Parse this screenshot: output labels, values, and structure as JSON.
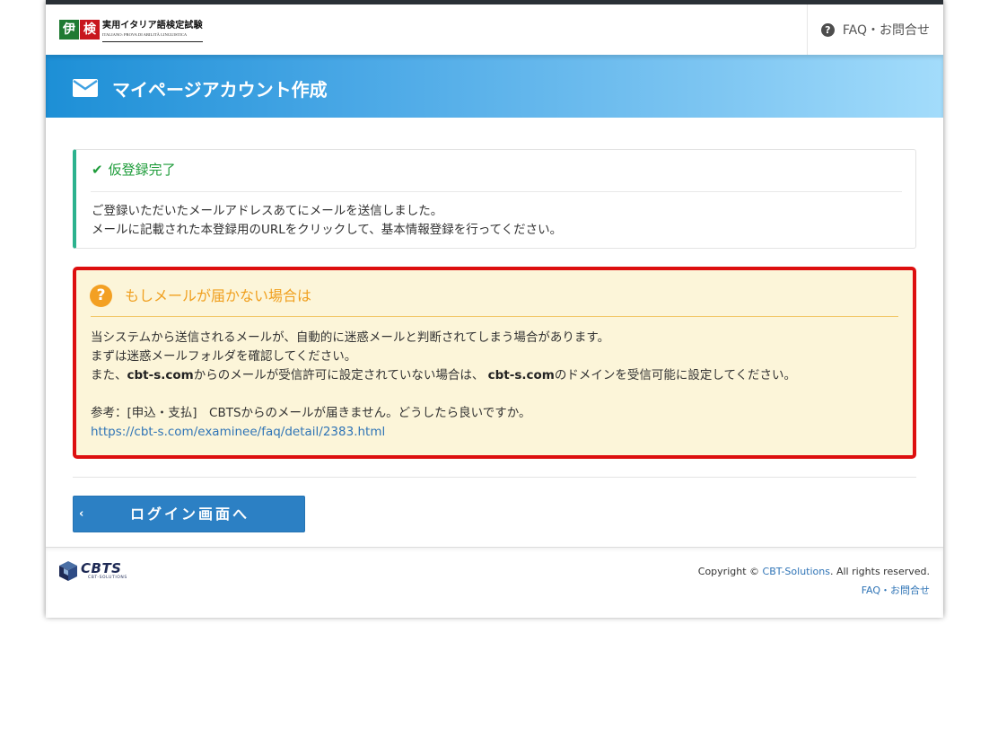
{
  "header": {
    "logo": {
      "mark_left": "伊",
      "mark_right": "検",
      "title": "実用イタリア語検定試験",
      "subtitle": "ITALIANO: PROVA DI ABILITÀ LINGUISTICA"
    },
    "faq_link": "FAQ・お問合せ",
    "faq_icon": "question-circle-icon"
  },
  "banner": {
    "icon": "envelope-icon",
    "title": "マイページアカウント作成"
  },
  "success_panel": {
    "icon": "check-icon",
    "title": "仮登録完了",
    "lines": [
      "ご登録いただいたメールアドレスあてにメールを送信しました。",
      "メールに記載された本登録用のURLをクリックして、基本情報登録を行ってください。"
    ]
  },
  "warning_panel": {
    "icon": "question-circle-icon",
    "title": "もしメールが届かない場合は",
    "line1": "当システムから送信されるメールが、自動的に迷惑メールと判断されてしまう場合があります。",
    "line2": "まずは迷惑メールフォルダを確認してください。",
    "line3_prefix": "また、",
    "line3_domain1": "cbt-s.com",
    "line3_middle": "からのメールが受信許可に設定されていない場合は、 ",
    "line3_domain2": "cbt-s.com",
    "line3_suffix": "のドメインを受信可能に設定してください。",
    "reference": "参考：[申込・支払]　CBTSからのメールが届きません。どうしたら良いですか。",
    "reference_url": "https://cbt-s.com/examinee/faq/detail/2383.html"
  },
  "login_button": {
    "chevron": "‹",
    "label": "ログイン画面へ"
  },
  "footer": {
    "logo_text": "CBTS",
    "logo_sub": "CBT-SOLUTIONS",
    "copyright_prefix": "Copyright © ",
    "copyright_link": "CBT-Solutions",
    "copyright_suffix": ". All rights reserved.",
    "faq_link": "FAQ・お問合せ"
  },
  "colors": {
    "banner_start": "#1d8fd6",
    "banner_end": "#a3dcfb",
    "success_accent": "#2cb28e",
    "success_text": "#1e9c3a",
    "warning_border": "#dd0f0f",
    "warning_bg": "#fcf5d9",
    "warning_title": "#f0a020",
    "link": "#2f74b6",
    "button": "#2c80c4"
  }
}
